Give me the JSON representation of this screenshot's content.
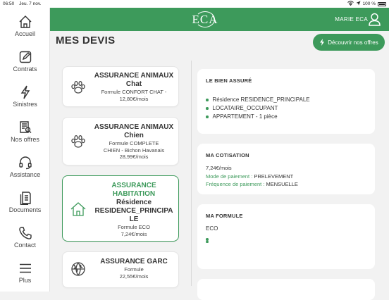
{
  "status_bar": {
    "time": "06:50",
    "date": "Jeu. 7 nov.",
    "battery": "100 %"
  },
  "sidebar": {
    "items": [
      {
        "label": "Accueil",
        "icon": "home-icon"
      },
      {
        "label": "Contrats",
        "icon": "edit-icon"
      },
      {
        "label": "Sinistres",
        "icon": "lightning-icon"
      },
      {
        "label": "Nos offres",
        "icon": "offers-icon"
      },
      {
        "label": "Assistance",
        "icon": "headset-icon"
      },
      {
        "label": "Documents",
        "icon": "documents-icon"
      },
      {
        "label": "Contact",
        "icon": "phone-icon"
      },
      {
        "label": "Plus",
        "icon": "menu-icon"
      }
    ]
  },
  "header": {
    "logo_text": "ECA",
    "user_name": "MARIE ECA"
  },
  "page": {
    "title": "MES DEVIS",
    "discover_button": "Découvrir nos offres"
  },
  "quotes": [
    {
      "title_lines": [
        "ASSURANCE ANIMAUX",
        "Chat"
      ],
      "detail_lines": [
        "Formule CONFORT CHAT -",
        "12,80€/mois"
      ],
      "icon": "paw-icon"
    },
    {
      "title_lines": [
        "ASSURANCE ANIMAUX",
        "Chien"
      ],
      "detail_lines": [
        "Formule COMPLETE",
        "CHIEN - Bichon Havanais",
        "28,99€/mois"
      ],
      "icon": "paw-icon"
    },
    {
      "title_lines": [
        "ASSURANCE",
        "HABITATION",
        "Résidence",
        "RESIDENCE_PRINCIPA",
        "LE"
      ],
      "detail_lines": [
        "Formule ECO",
        "7,24€/mois"
      ],
      "icon": "house-icon"
    },
    {
      "title_lines": [
        "ASSURANCE GARC"
      ],
      "detail_lines": [
        "Formule",
        "22,55€/mois"
      ],
      "icon": "globe-icon"
    }
  ],
  "details": {
    "bien_assure": {
      "heading": "LE BIEN ASSURÉ",
      "items": [
        "Résidence RESIDENCE_PRINCIPALE",
        "LOCATAIRE_OCCUPANT",
        "APPARTEMENT - 1 pièce"
      ]
    },
    "cotisation": {
      "heading": "MA COTISATION",
      "amount": "7,24€/mois",
      "payment_mode_label": "Mode de paiement :",
      "payment_mode_value": "PRELEVEMENT",
      "frequency_label": "Fréquence de paiement :",
      "frequency_value": "MENSUELLE"
    },
    "formule": {
      "heading": "MA FORMULE",
      "name": "ECO",
      "items": [
        "",
        ""
      ]
    }
  },
  "colors": {
    "brand_green": "#3d9a5b",
    "background": "#f2f2f2"
  }
}
